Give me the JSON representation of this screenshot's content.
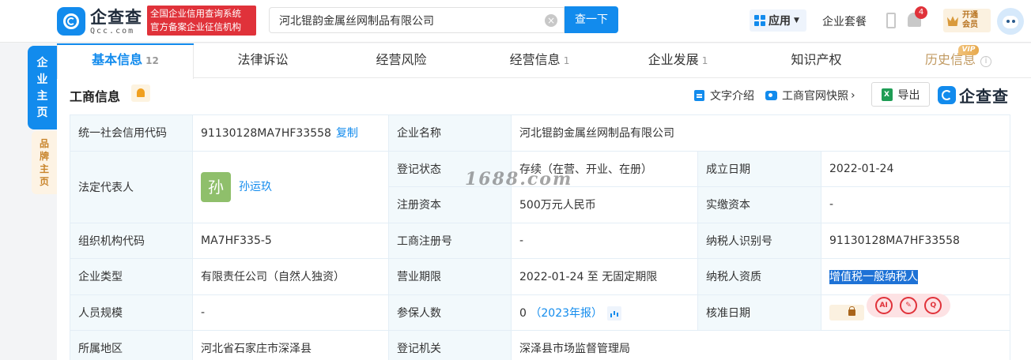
{
  "header": {
    "logo_cn": "企查查",
    "logo_en": "Qcc.com",
    "badge_line1": "全国企业信用查询系统",
    "badge_line2": "官方备案企业征信机构",
    "search_value": "河北锟韵金属丝网制品有限公司",
    "search_button": "查一下",
    "apps_label": "应用",
    "plan_label": "企业套餐",
    "notification_count": "4",
    "vip_line1": "开通",
    "vip_line2": "会员"
  },
  "side": {
    "main_tab": "企业主页",
    "brand_tab": "品牌主页"
  },
  "tabs": [
    {
      "label": "基本信息",
      "count": "12"
    },
    {
      "label": "法律诉讼",
      "count": ""
    },
    {
      "label": "经营风险",
      "count": ""
    },
    {
      "label": "经营信息",
      "count": "1"
    },
    {
      "label": "企业发展",
      "count": "1"
    },
    {
      "label": "知识产权",
      "count": ""
    },
    {
      "label": "历史信息",
      "count": ""
    }
  ],
  "vip_tag": "VIP",
  "section": {
    "title": "工商信息",
    "text_intro": "文字介绍",
    "snapshot": "工商官网快照",
    "export": "导出",
    "brand": "企查查"
  },
  "table": {
    "credit_code_label": "统一社会信用代码",
    "credit_code_value": "91130128MA7HF33558",
    "copy": "复制",
    "company_name_label": "企业名称",
    "company_name_value": "河北锟韵金属丝网制品有限公司",
    "legal_rep_label": "法定代表人",
    "legal_rep_avatar": "孙",
    "legal_rep_name": "孙运玖",
    "reg_status_label": "登记状态",
    "reg_status_value": "存续（在营、开业、在册）",
    "founded_label": "成立日期",
    "founded_value": "2022-01-24",
    "reg_capital_label": "注册资本",
    "reg_capital_value": "500万元人民币",
    "paid_capital_label": "实缴资本",
    "paid_capital_value": "-",
    "org_code_label": "组织机构代码",
    "org_code_value": "MA7HF335-5",
    "biz_reg_no_label": "工商注册号",
    "biz_reg_no_value": "-",
    "taxpayer_id_label": "纳税人识别号",
    "taxpayer_id_value": "91130128MA7HF33558",
    "company_type_label": "企业类型",
    "company_type_value": "有限责任公司（自然人独资）",
    "biz_term_label": "营业期限",
    "biz_term_value": "2022-01-24 至 无固定期限",
    "taxpayer_qual_label": "纳税人资质",
    "taxpayer_qual_value": "增值税一般纳税人",
    "staff_size_label": "人员规模",
    "staff_size_value": "-",
    "insured_label": "参保人数",
    "insured_value": "0",
    "insured_year": "（2023年报）",
    "approval_date_label": "核准日期",
    "region_label": "所属地区",
    "region_value": "河北省石家庄市深泽县",
    "reg_authority_label": "登记机关",
    "reg_authority_value": "深泽县市场监督管理局"
  },
  "watermark": "1688.com",
  "float_tools": [
    "AI",
    "✎",
    "Q"
  ]
}
